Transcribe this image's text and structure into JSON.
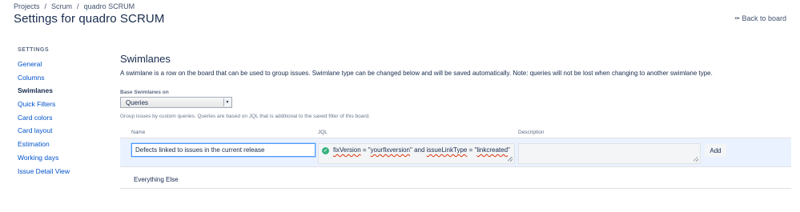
{
  "breadcrumb": {
    "items": [
      "Projects",
      "Scrum",
      "quadro SCRUM"
    ],
    "separator": "/"
  },
  "page": {
    "title": "Settings for quadro SCRUM",
    "back_link": "Back to board"
  },
  "sidebar": {
    "heading": "SETTINGS",
    "items": [
      {
        "label": "General",
        "active": false
      },
      {
        "label": "Columns",
        "active": false
      },
      {
        "label": "Swimlanes",
        "active": true
      },
      {
        "label": "Quick Filters",
        "active": false
      },
      {
        "label": "Card colors",
        "active": false
      },
      {
        "label": "Card layout",
        "active": false
      },
      {
        "label": "Estimation",
        "active": false
      },
      {
        "label": "Working days",
        "active": false
      },
      {
        "label": "Issue Detail View",
        "active": false
      }
    ]
  },
  "swimlanes": {
    "title": "Swimlanes",
    "description": "A swimlane is a row on the board that can be used to group issues. Swimlane type can be changed below and will be saved automatically. Note: queries will not be lost when changing to another swimlane type.",
    "base_label": "Base Swimlanes on",
    "base_value": "Queries",
    "help_text": "Group issues by custom queries. Queries are based on JQL that is additional to the saved filter of this board.",
    "columns": {
      "name": "Name",
      "jql": "JQL",
      "description": "Description"
    },
    "new_row": {
      "name_value": "Defects linked to issues in the current release",
      "jql_parts": [
        "fixVersion",
        " = \"",
        "yourfixversion",
        "\" and ",
        "issueLinkType",
        " = \"",
        "linkcreated",
        "\""
      ],
      "description_value": "",
      "add_label": "Add"
    },
    "rows": [
      {
        "name": "Everything Else"
      }
    ]
  },
  "colors": {
    "link": "#0052cc",
    "valid": "#36b37e",
    "row_highlight": "#ebf2ff",
    "error_underline": "#de350b"
  }
}
